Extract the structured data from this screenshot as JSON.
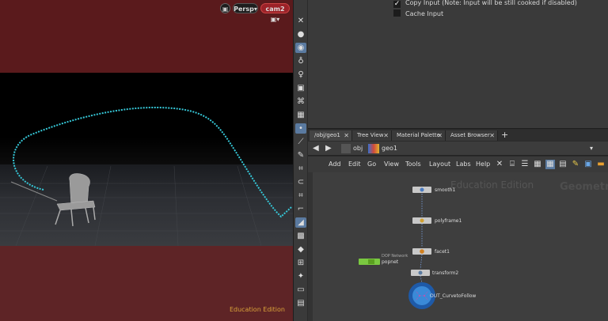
{
  "viewport": {
    "lock_icon": "lock-icon",
    "view_mode": "Persp",
    "camera": "cam2",
    "camera_lock_icon": "lock-icon",
    "watermark": "Education Edition"
  },
  "viewport_toolbar": {
    "icons": [
      "close-icon",
      "sphere-icon",
      "light-icon",
      "bulb-icon",
      "light-icon",
      "camera-icon",
      "snap-icon",
      "render-icon",
      "point-icon",
      "brush-icon",
      "pen-icon",
      "handle-icon",
      "magnet-icon",
      "handle-icon",
      "curve-icon",
      "select-icon",
      "grid-icon",
      "shape-icon",
      "group-icon",
      "move-icon",
      "monitor-icon",
      "image-icon"
    ]
  },
  "params": {
    "copy_input_label": "Copy Input (Note: Input will be still cooked if disabled)",
    "copy_input_checked": true,
    "cache_input_label": "Cache Input",
    "cache_input_checked": false
  },
  "tabs": [
    {
      "label": "/obj/geo1",
      "active": true
    },
    {
      "label": "Tree View",
      "active": false
    },
    {
      "label": "Material Palette",
      "active": false
    },
    {
      "label": "Asset Browser",
      "active": false
    }
  ],
  "add_tab": "+",
  "path": {
    "back": "◀",
    "forward": "▶",
    "obj": "obj",
    "geo": "geo1"
  },
  "menu": [
    "Add",
    "Edit",
    "Go",
    "View",
    "Tools",
    "Layout",
    "Labs",
    "Help"
  ],
  "network": {
    "watermark_edu": "Education Edition",
    "watermark_context": "Geometr",
    "nodes": [
      {
        "name": "smooth1"
      },
      {
        "name": "polyframe1"
      },
      {
        "name": "facet1"
      },
      {
        "name": "transform2"
      },
      {
        "name": "OUT_CurvetoFollow"
      },
      {
        "name": "popnet"
      }
    ],
    "popnet_badge": "DOP Network"
  }
}
